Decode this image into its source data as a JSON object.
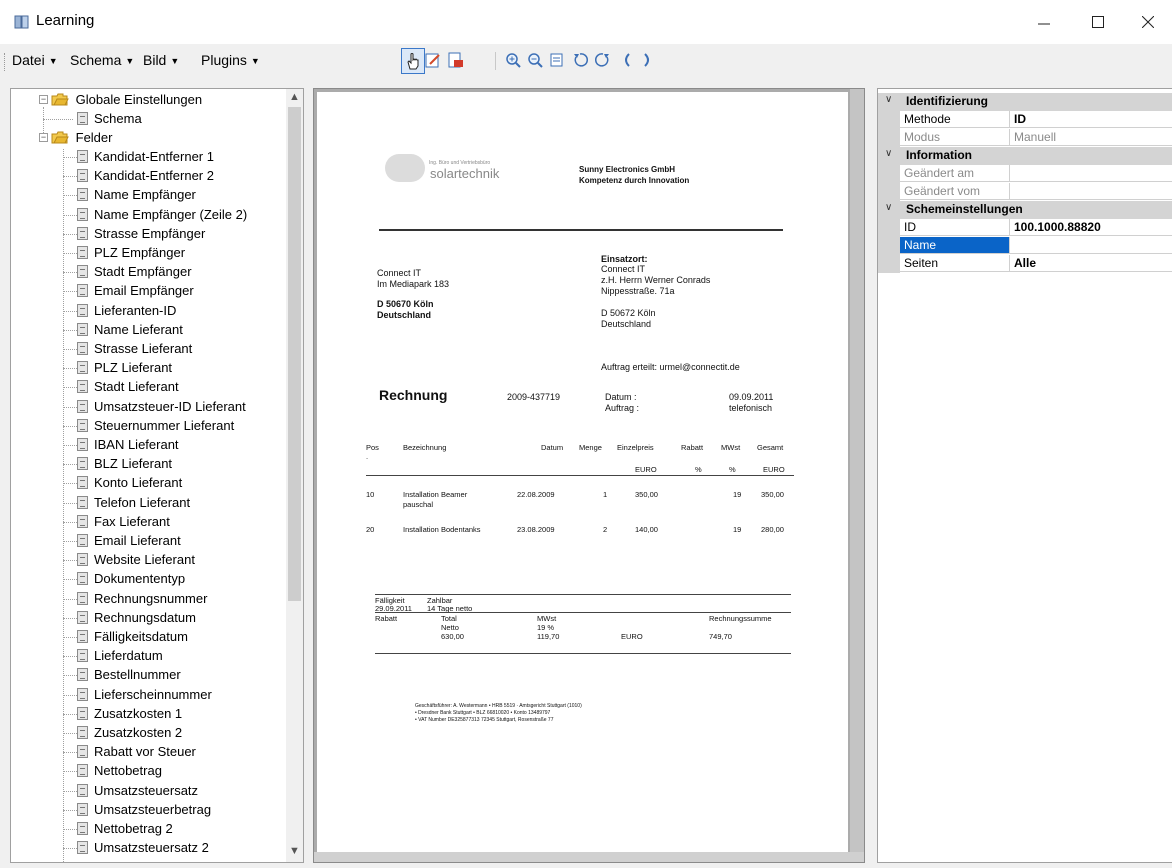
{
  "window": {
    "title": "Learning"
  },
  "menubar": {
    "items": [
      {
        "label": "Datei"
      },
      {
        "label": "Schema"
      },
      {
        "label": "Bild"
      },
      {
        "label": "Plugins"
      }
    ]
  },
  "toolbar": {
    "icons": [
      "pointer-hand-icon",
      "edit-icon",
      "delete-region-icon",
      "zoom-in-icon",
      "zoom-out-icon",
      "fit-page-icon",
      "rotate-left-icon",
      "rotate-right-icon",
      "previous-page-icon",
      "next-page-icon"
    ]
  },
  "tree": {
    "root1": "Globale Einstellungen",
    "root1_children": [
      "Schema"
    ],
    "root2": "Felder",
    "fields": [
      "Kandidat-Entferner 1",
      "Kandidat-Entferner 2",
      "Name Empfänger",
      "Name Empfänger (Zeile 2)",
      "Strasse Empfänger",
      "PLZ Empfänger",
      "Stadt Empfänger",
      "Email Empfänger",
      "Lieferanten-ID",
      "Name Lieferant",
      "Strasse Lieferant",
      "PLZ Lieferant",
      "Stadt Lieferant",
      "Umsatzsteuer-ID Lieferant",
      "Steuernummer Lieferant",
      "IBAN Lieferant",
      "BLZ Lieferant",
      "Konto Lieferant",
      "Telefon Lieferant",
      "Fax Lieferant",
      "Email Lieferant",
      "Website Lieferant",
      "Dokumententyp",
      "Rechnungsnummer",
      "Rechnungsdatum",
      "Fälligkeitsdatum",
      "Lieferdatum",
      "Bestellnummer",
      "Lieferscheinnummer",
      "Zusatzkosten 1",
      "Zusatzkosten 2",
      "Rabatt vor Steuer",
      "Nettobetrag",
      "Umsatzsteuersatz",
      "Umsatzsteuerbetrag",
      "Nettobetrag 2",
      "Umsatzsteuersatz 2"
    ]
  },
  "document": {
    "logo_small": "Ing. Büro und Vertriebsbüro",
    "logo_word": "solartechnik",
    "company_line1": "Sunny Electronics GmbH",
    "company_line2": "Kompetenz durch Innovation",
    "recipient": [
      "Connect IT",
      "Im Mediapark 183"
    ],
    "recipient_city": "D 50670 Köln",
    "recipient_country": "Deutschland",
    "einsatzort_label": "Einsatzort:",
    "einsatzort": [
      "Connect IT",
      "z.H. Herrn Werner Conrads",
      "Nippesstraße. 71a"
    ],
    "einsatzort_city": [
      "D 50672 Köln",
      "Deutschland"
    ],
    "auftrag_erteilt": "Auftrag erteilt: urmel@connectit.de",
    "heading": "Rechnung",
    "invoice_number": "2009-437719",
    "datum_label": "Datum :",
    "datum_value": "09.09.2011",
    "auftrag_label": "Auftrag :",
    "auftrag_value": "telefonisch",
    "table_headers": [
      "Pos",
      "Bezeichnung",
      "Datum",
      "Menge",
      "Einzelpreis",
      "Rabatt",
      "MWst",
      "Gesamt"
    ],
    "pos_dot": ".",
    "units": [
      "EURO",
      "%",
      "%",
      "EURO"
    ],
    "rows": [
      {
        "pos": "10",
        "desc": "Installation Beamer",
        "desc2": "pauschal",
        "date": "22.08.2009",
        "qty": "1",
        "price": "350,00",
        "mwst": "19",
        "total": "350,00"
      },
      {
        "pos": "20",
        "desc": "Installation Bodentanks",
        "desc2": "",
        "date": "23.08.2009",
        "qty": "2",
        "price": "140,00",
        "mwst": "19",
        "total": "280,00"
      }
    ],
    "faelligkeit_label": "Fälligkeit",
    "faelligkeit_date": "29.09.2011",
    "zahlbar_label": "Zahlbar",
    "zahlbar_value": "14 Tage netto",
    "rabatt_label": "Rabatt",
    "total_label": "Total",
    "netto_label": "Netto",
    "netto_value": "630,00",
    "mwst_label": "MWst",
    "mwst_rate": "19 %",
    "mwst_amount": "119,70",
    "euro": "EURO",
    "rechnungssumme_label": "Rechnungssumme",
    "rechnungssumme_value": "749,70",
    "footer": [
      "Geschäftsführer: A. Westermann • HRB 5519 · Amtsgericht Stuttgart (1010)",
      "• Dresdner Bank Stuttgart • BLZ 66810020 • Konto 13489797",
      "• VAT Number DE325877313 72345 Stuttgart, Rosenstraße 77"
    ]
  },
  "properties": {
    "categories": [
      {
        "label": "Identifizierung",
        "rows": [
          {
            "name": "Methode",
            "value": "ID",
            "state": "normal"
          },
          {
            "name": "Modus",
            "value": "Manuell",
            "state": "gray"
          }
        ]
      },
      {
        "label": "Information",
        "rows": [
          {
            "name": "Geändert am",
            "value": "",
            "state": "gray"
          },
          {
            "name": "Geändert vom",
            "value": "",
            "state": "gray"
          }
        ]
      },
      {
        "label": "Schemeinstellungen",
        "rows": [
          {
            "name": "ID",
            "value": "100.1000.88820",
            "state": "normal"
          },
          {
            "name": "Name",
            "value": "",
            "state": "selected"
          },
          {
            "name": "Seiten",
            "value": "Alle",
            "state": "normal"
          }
        ]
      }
    ]
  },
  "colors": {
    "selection": "#0a64c8",
    "folder": "#e8b730",
    "category": "#d4d4d4"
  }
}
